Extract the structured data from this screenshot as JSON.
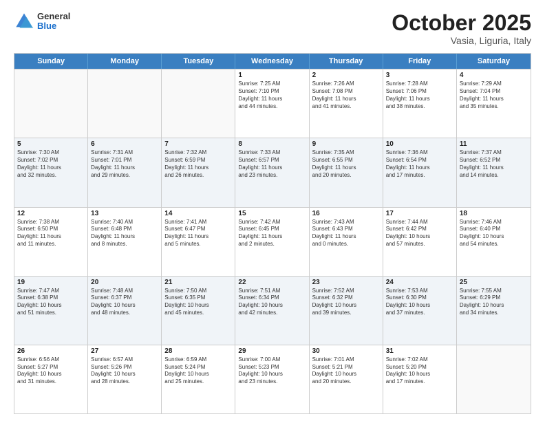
{
  "header": {
    "logo": {
      "general": "General",
      "blue": "Blue"
    },
    "title": "October 2025",
    "location": "Vasia, Liguria, Italy"
  },
  "calendar": {
    "days": [
      "Sunday",
      "Monday",
      "Tuesday",
      "Wednesday",
      "Thursday",
      "Friday",
      "Saturday"
    ],
    "rows": [
      {
        "alt": false,
        "cells": [
          {
            "day": "",
            "info": ""
          },
          {
            "day": "",
            "info": ""
          },
          {
            "day": "",
            "info": ""
          },
          {
            "day": "1",
            "info": "Sunrise: 7:25 AM\nSunset: 7:10 PM\nDaylight: 11 hours\nand 44 minutes."
          },
          {
            "day": "2",
            "info": "Sunrise: 7:26 AM\nSunset: 7:08 PM\nDaylight: 11 hours\nand 41 minutes."
          },
          {
            "day": "3",
            "info": "Sunrise: 7:28 AM\nSunset: 7:06 PM\nDaylight: 11 hours\nand 38 minutes."
          },
          {
            "day": "4",
            "info": "Sunrise: 7:29 AM\nSunset: 7:04 PM\nDaylight: 11 hours\nand 35 minutes."
          }
        ]
      },
      {
        "alt": true,
        "cells": [
          {
            "day": "5",
            "info": "Sunrise: 7:30 AM\nSunset: 7:02 PM\nDaylight: 11 hours\nand 32 minutes."
          },
          {
            "day": "6",
            "info": "Sunrise: 7:31 AM\nSunset: 7:01 PM\nDaylight: 11 hours\nand 29 minutes."
          },
          {
            "day": "7",
            "info": "Sunrise: 7:32 AM\nSunset: 6:59 PM\nDaylight: 11 hours\nand 26 minutes."
          },
          {
            "day": "8",
            "info": "Sunrise: 7:33 AM\nSunset: 6:57 PM\nDaylight: 11 hours\nand 23 minutes."
          },
          {
            "day": "9",
            "info": "Sunrise: 7:35 AM\nSunset: 6:55 PM\nDaylight: 11 hours\nand 20 minutes."
          },
          {
            "day": "10",
            "info": "Sunrise: 7:36 AM\nSunset: 6:54 PM\nDaylight: 11 hours\nand 17 minutes."
          },
          {
            "day": "11",
            "info": "Sunrise: 7:37 AM\nSunset: 6:52 PM\nDaylight: 11 hours\nand 14 minutes."
          }
        ]
      },
      {
        "alt": false,
        "cells": [
          {
            "day": "12",
            "info": "Sunrise: 7:38 AM\nSunset: 6:50 PM\nDaylight: 11 hours\nand 11 minutes."
          },
          {
            "day": "13",
            "info": "Sunrise: 7:40 AM\nSunset: 6:48 PM\nDaylight: 11 hours\nand 8 minutes."
          },
          {
            "day": "14",
            "info": "Sunrise: 7:41 AM\nSunset: 6:47 PM\nDaylight: 11 hours\nand 5 minutes."
          },
          {
            "day": "15",
            "info": "Sunrise: 7:42 AM\nSunset: 6:45 PM\nDaylight: 11 hours\nand 2 minutes."
          },
          {
            "day": "16",
            "info": "Sunrise: 7:43 AM\nSunset: 6:43 PM\nDaylight: 11 hours\nand 0 minutes."
          },
          {
            "day": "17",
            "info": "Sunrise: 7:44 AM\nSunset: 6:42 PM\nDaylight: 10 hours\nand 57 minutes."
          },
          {
            "day": "18",
            "info": "Sunrise: 7:46 AM\nSunset: 6:40 PM\nDaylight: 10 hours\nand 54 minutes."
          }
        ]
      },
      {
        "alt": true,
        "cells": [
          {
            "day": "19",
            "info": "Sunrise: 7:47 AM\nSunset: 6:38 PM\nDaylight: 10 hours\nand 51 minutes."
          },
          {
            "day": "20",
            "info": "Sunrise: 7:48 AM\nSunset: 6:37 PM\nDaylight: 10 hours\nand 48 minutes."
          },
          {
            "day": "21",
            "info": "Sunrise: 7:50 AM\nSunset: 6:35 PM\nDaylight: 10 hours\nand 45 minutes."
          },
          {
            "day": "22",
            "info": "Sunrise: 7:51 AM\nSunset: 6:34 PM\nDaylight: 10 hours\nand 42 minutes."
          },
          {
            "day": "23",
            "info": "Sunrise: 7:52 AM\nSunset: 6:32 PM\nDaylight: 10 hours\nand 39 minutes."
          },
          {
            "day": "24",
            "info": "Sunrise: 7:53 AM\nSunset: 6:30 PM\nDaylight: 10 hours\nand 37 minutes."
          },
          {
            "day": "25",
            "info": "Sunrise: 7:55 AM\nSunset: 6:29 PM\nDaylight: 10 hours\nand 34 minutes."
          }
        ]
      },
      {
        "alt": false,
        "cells": [
          {
            "day": "26",
            "info": "Sunrise: 6:56 AM\nSunset: 5:27 PM\nDaylight: 10 hours\nand 31 minutes."
          },
          {
            "day": "27",
            "info": "Sunrise: 6:57 AM\nSunset: 5:26 PM\nDaylight: 10 hours\nand 28 minutes."
          },
          {
            "day": "28",
            "info": "Sunrise: 6:59 AM\nSunset: 5:24 PM\nDaylight: 10 hours\nand 25 minutes."
          },
          {
            "day": "29",
            "info": "Sunrise: 7:00 AM\nSunset: 5:23 PM\nDaylight: 10 hours\nand 23 minutes."
          },
          {
            "day": "30",
            "info": "Sunrise: 7:01 AM\nSunset: 5:21 PM\nDaylight: 10 hours\nand 20 minutes."
          },
          {
            "day": "31",
            "info": "Sunrise: 7:02 AM\nSunset: 5:20 PM\nDaylight: 10 hours\nand 17 minutes."
          },
          {
            "day": "",
            "info": ""
          }
        ]
      }
    ]
  }
}
